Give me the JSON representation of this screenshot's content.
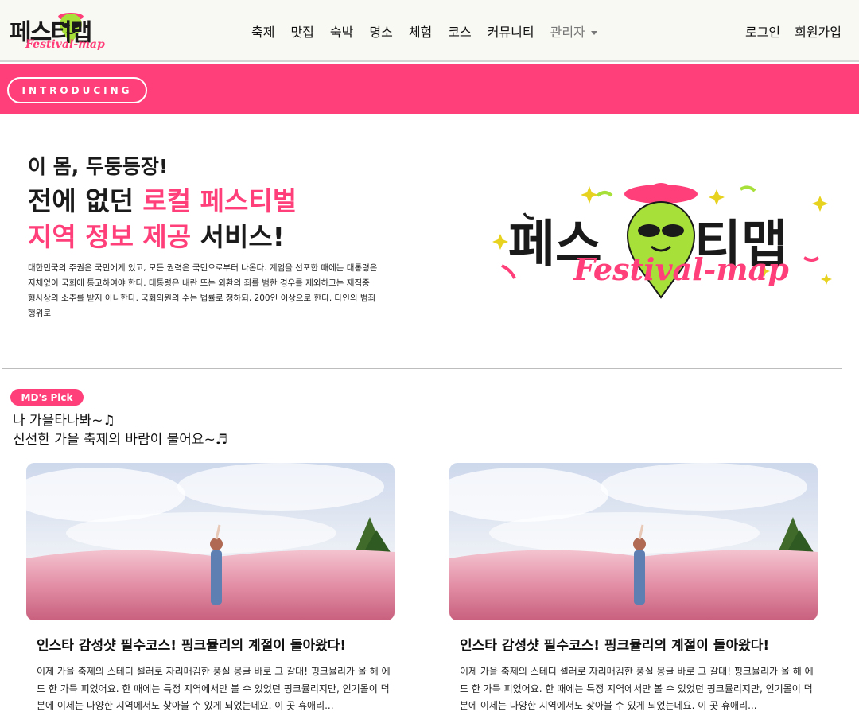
{
  "brand": {
    "logo_text": "페스티맵",
    "logo_script": "Festival-map",
    "pink": "#ff3f79",
    "green": "#a8e03a"
  },
  "nav": {
    "items": [
      "축제",
      "맛집",
      "숙박",
      "명소",
      "체험",
      "코스",
      "커뮤니티"
    ],
    "admin_label": "관리자",
    "login_label": "로그인",
    "signup_label": "회원가입"
  },
  "intro": {
    "label": "INTRODUCING"
  },
  "banner": {
    "line1": "이 몸, 두둥등장!",
    "line2_a": "전에 없던 ",
    "line2_b": "로컬 페스티벌",
    "line3_a": "지역 정보 제공",
    "line3_b": " 서비스!",
    "description": "대한민국의 주권은 국민에게 있고, 모든 권력은 국민으로부터 나온다. 계엄을 선포한 때에는 대통령은 지체없이 국회에 통고하여야 한다. 대통령은 내란 또는 외환의 죄를 범한 경우를 제외하고는 재직중 형사상의 소추를 받지 아니한다. 국회의원의 수는 법률로 정하되, 200인 이상으로 한다. 타인의 범죄행위로",
    "big_logo_text_left": "페스",
    "big_logo_text_right": "티맵",
    "big_logo_script": "Festival-map"
  },
  "md_pick": {
    "badge": "MD's Pick",
    "title_line1": "나 가을타나봐~♫",
    "title_line2": "신선한 가을 축제의 바람이 불어요~♬"
  },
  "cards": [
    {
      "title": "인스타 감성샷 필수코스! 핑크뮬리의 계절이 돌아왔다!",
      "description": "이제 가을 축제의 스테디 셀러로 자리매김한 풍실 몽글 바로 그 갈대! 핑크뮬리가 올 해 에도 한 가득 피었어요. 한 때에는 특정 지역에서만 볼 수 있었던 핑크뮬리지만, 인기몰이 덕분에 이제는 다양한 지역에서도 찾아볼 수 있게 되었는데요. 이 곳 휴애리..."
    },
    {
      "title": "인스타 감성샷 필수코스! 핑크뮬리의 계절이 돌아왔다!",
      "description": "이제 가을 축제의 스테디 셀러로 자리매김한 풍실 몽글 바로 그 갈대! 핑크뮬리가 올 해 에도 한 가득 피었어요. 한 때에는 특정 지역에서만 볼 수 있었던 핑크뮬리지만, 인기몰이 덕분에 이제는 다양한 지역에서도 찾아볼 수 있게 되었는데요. 이 곳 휴애리..."
    }
  ]
}
